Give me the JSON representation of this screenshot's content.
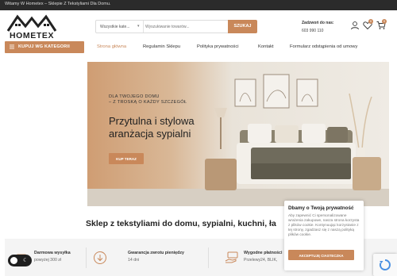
{
  "topbar": {
    "text": "Witamy W Hometex – Sklepie Z Tekstyliami Dla Domu."
  },
  "logo": {
    "text": "HOMETEX"
  },
  "search": {
    "category": "Wszystkie kate...",
    "placeholder": "Wyszukiwanie towarów...",
    "button": "SZUKAJ"
  },
  "contact": {
    "label": "Zadzwoń do nas:",
    "phone": "603 990 110"
  },
  "header_icons": {
    "wishlist_count": "0",
    "cart_count": "0"
  },
  "category_button": {
    "label": "KUPUJ WG KATEGORII"
  },
  "nav": {
    "home": "Strona główna",
    "rules": "Regulamin Sklepu",
    "privacy": "Polityka prywatności",
    "contact": "Kontakt",
    "withdrawal": "Formularz odstąpienia od umowy"
  },
  "hero": {
    "eyebrow_line1": "DLA TWOJEGO DOMU",
    "eyebrow_line2": "– Z TROSKĄ O KAŻDY SZCZEGÓŁ",
    "title_line1": "Przytulna i stylowa",
    "title_line2": "aranżacja sypialni",
    "button": "KUP TERAZ"
  },
  "section": {
    "title": "Sklep z tekstyliami do domu, sypialni, kuchni, ła"
  },
  "features": {
    "shipping_title": "Darmowa wysyłka",
    "shipping_sub": "powyżej 300 zł",
    "return_title": "Gwarancja zwrotu pieniędzy",
    "return_sub": "14 dni",
    "payment_title": "Wygodne płatności",
    "payment_sub": "Przelewy24, BLIK,"
  },
  "cookie": {
    "title": "Dbamy o Twoją prywatność",
    "body": "Aby zapewnić Ci spersonalizowane wrażenia zakupowe, nasza strona korzysta z plików cookie. Kontynuując korzystanie z tej strony, zgadzasz się z naszą polityką plików cookie.",
    "button": "AKCEPTUJĘ CIASTECZKA"
  },
  "colors": {
    "accent": "#c9885a",
    "topbar": "#2b2b2b"
  }
}
